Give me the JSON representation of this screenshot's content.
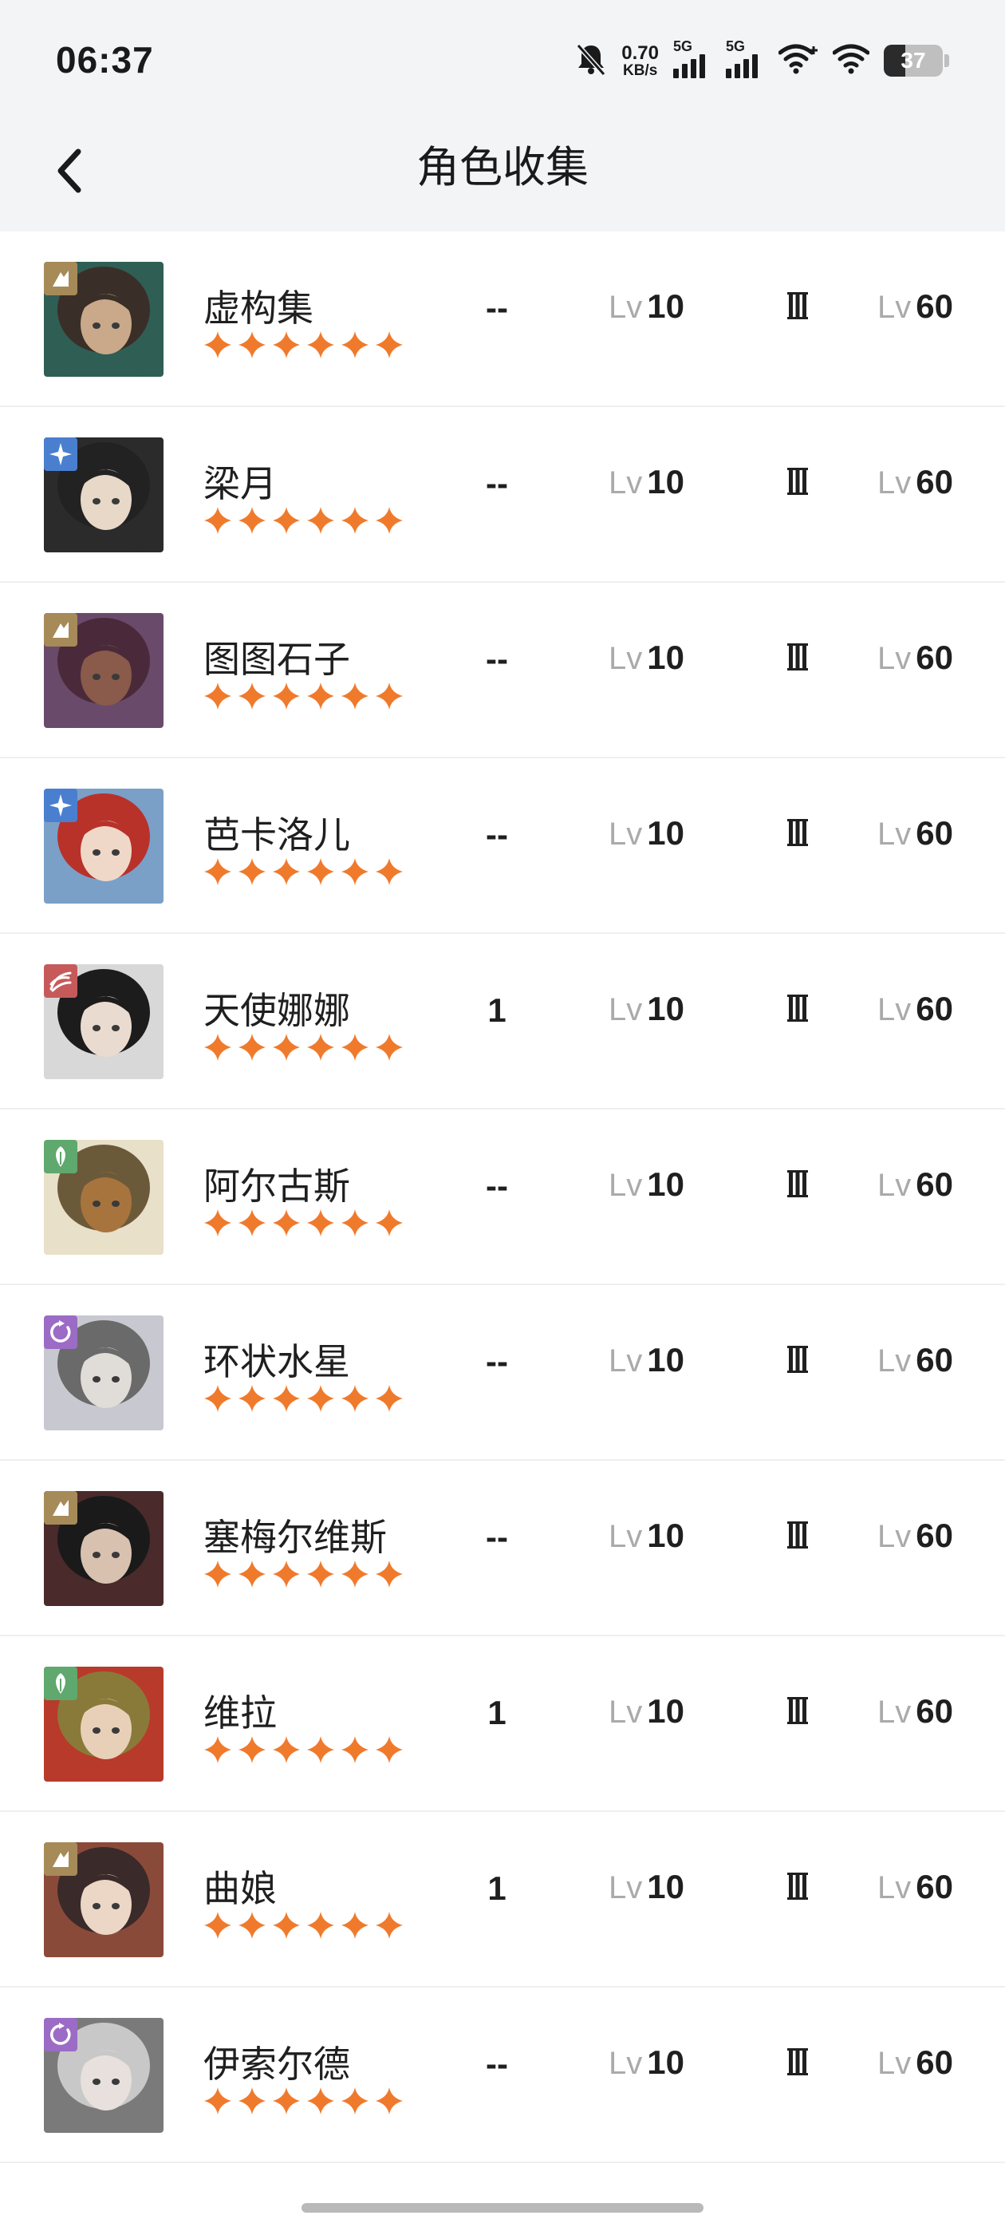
{
  "status_bar": {
    "time": "06:37",
    "net_speed_value": "0.70",
    "net_speed_unit": "KB/s",
    "sim1_label": "5G",
    "sim2_label": "5G",
    "battery_percent": "37",
    "icons": [
      "mute-bell-icon",
      "signal-icon",
      "signal-icon",
      "wifi-plus-icon",
      "wifi-icon",
      "battery-icon"
    ]
  },
  "header": {
    "title": "角色收集",
    "back_icon": "chevron-left-icon"
  },
  "colors": {
    "star": "#F07A2C",
    "accent_text": "#1f1f1f",
    "muted_text": "#aaaaaa",
    "header_bg": "#f3f4f6",
    "element_gold": "#A68A58",
    "element_blue": "#4A7FD0",
    "element_red": "#C65A5A",
    "element_green": "#5FA86E",
    "element_purple": "#9B6BC6"
  },
  "level_prefix": "Lv",
  "characters": [
    {
      "name": "虚构集",
      "element": "gold",
      "stars": 6,
      "rank": "--",
      "level": "10",
      "insight": "III",
      "max_level": "60"
    },
    {
      "name": "梁月",
      "element": "blue",
      "stars": 6,
      "rank": "--",
      "level": "10",
      "insight": "III",
      "max_level": "60"
    },
    {
      "name": "图图石子",
      "element": "gold",
      "stars": 6,
      "rank": "--",
      "level": "10",
      "insight": "III",
      "max_level": "60"
    },
    {
      "name": "芭卡洛儿",
      "element": "blue",
      "stars": 6,
      "rank": "--",
      "level": "10",
      "insight": "III",
      "max_level": "60"
    },
    {
      "name": "天使娜娜",
      "element": "red",
      "stars": 6,
      "rank": "1",
      "level": "10",
      "insight": "III",
      "max_level": "60"
    },
    {
      "name": "阿尔古斯",
      "element": "green",
      "stars": 6,
      "rank": "--",
      "level": "10",
      "insight": "III",
      "max_level": "60"
    },
    {
      "name": "环状水星",
      "element": "purple",
      "stars": 6,
      "rank": "--",
      "level": "10",
      "insight": "III",
      "max_level": "60"
    },
    {
      "name": "塞梅尔维斯",
      "element": "gold",
      "stars": 6,
      "rank": "--",
      "level": "10",
      "insight": "III",
      "max_level": "60"
    },
    {
      "name": "维拉",
      "element": "green",
      "stars": 6,
      "rank": "1",
      "level": "10",
      "insight": "III",
      "max_level": "60"
    },
    {
      "name": "曲娘",
      "element": "gold",
      "stars": 6,
      "rank": "1",
      "level": "10",
      "insight": "III",
      "max_level": "60"
    },
    {
      "name": "伊索尔德",
      "element": "purple",
      "stars": 6,
      "rank": "--",
      "level": "10",
      "insight": "III",
      "max_level": "60"
    }
  ]
}
